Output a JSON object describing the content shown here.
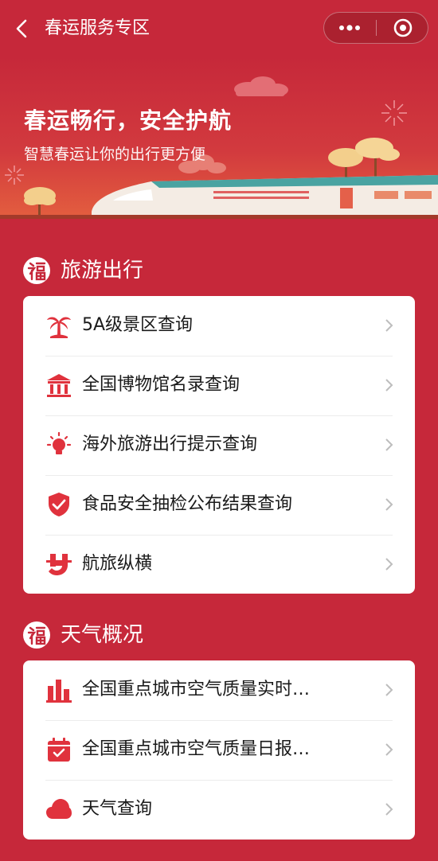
{
  "nav": {
    "title": "春运服务专区"
  },
  "banner": {
    "title": "春运畅行，安全护航",
    "subtitle": "智慧春运让你的出行更方便"
  },
  "sections": [
    {
      "title": "旅游出行",
      "items": [
        {
          "label": "5A级景区查询",
          "icon": "palm-tree-icon"
        },
        {
          "label": "全国博物馆名录查询",
          "icon": "museum-icon"
        },
        {
          "label": "海外旅游出行提示查询",
          "icon": "lightbulb-icon"
        },
        {
          "label": "食品安全抽检公布结果查询",
          "icon": "shield-check-icon"
        },
        {
          "label": "航旅纵横",
          "icon": "hanglv-logo-icon"
        }
      ]
    },
    {
      "title": "天气概况",
      "items": [
        {
          "label": "全国重点城市空气质量实时…",
          "icon": "bar-chart-icon"
        },
        {
          "label": "全国重点城市空气质量日报…",
          "icon": "calendar-check-icon"
        },
        {
          "label": "天气查询",
          "icon": "cloud-icon"
        }
      ]
    }
  ],
  "colors": {
    "background": "#c6283a",
    "accent": "#e0323d",
    "card": "#ffffff"
  }
}
